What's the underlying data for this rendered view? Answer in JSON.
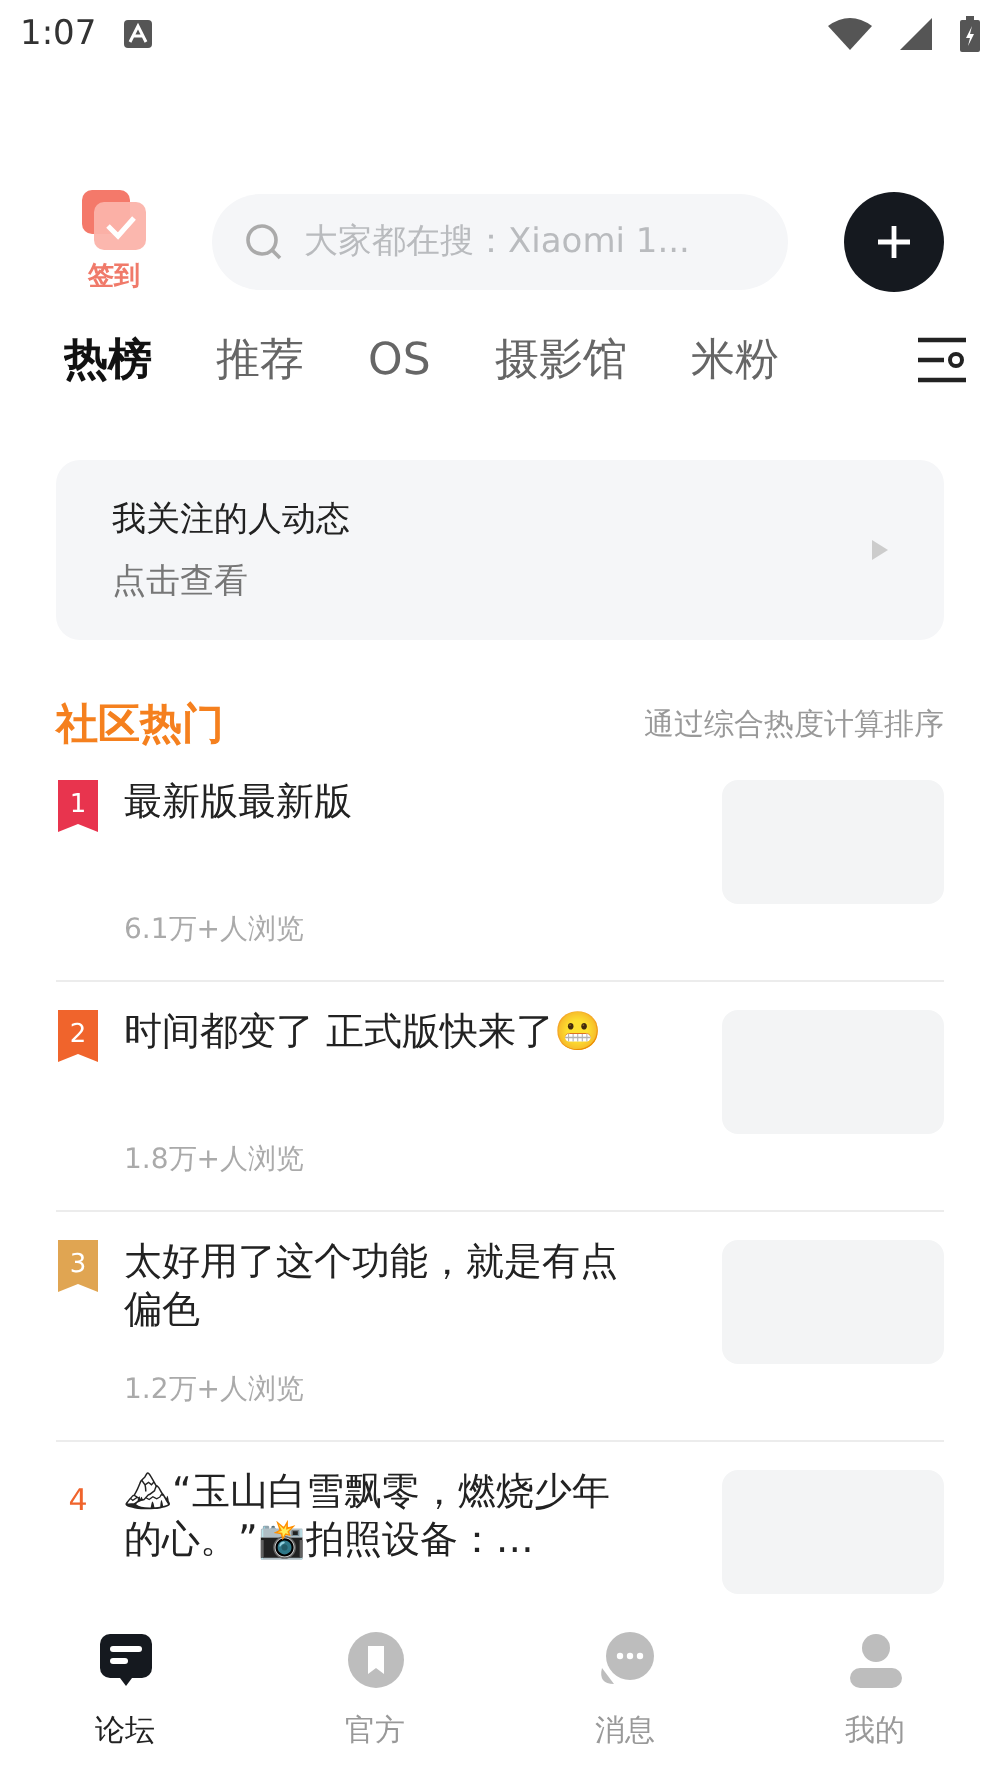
{
  "status_bar": {
    "time": "1:07"
  },
  "header": {
    "checkin_label": "签到",
    "search": {
      "placeholder": "大家都在搜：Xiaomi 1..."
    }
  },
  "tabs": [
    {
      "label": "热榜",
      "selected": true
    },
    {
      "label": "推荐",
      "selected": false
    },
    {
      "label": "OS",
      "selected": false
    },
    {
      "label": "摄影馆",
      "selected": false
    },
    {
      "label": "米粉",
      "selected": false
    }
  ],
  "follow_card": {
    "title": "我关注的人动态",
    "subtitle": "点击查看"
  },
  "section": {
    "title": "社区热门",
    "note": "通过综合热度计算排序"
  },
  "posts": [
    {
      "rank": "1",
      "kind": "ribbon",
      "color": "#e8344e",
      "title": "最新版最新版",
      "views": "6.1万+人浏览"
    },
    {
      "rank": "2",
      "kind": "ribbon",
      "color": "#f0642c",
      "title": "时间都变了 正式版快来了😬",
      "views": "1.8万+人浏览"
    },
    {
      "rank": "3",
      "kind": "ribbon",
      "color": "#e0a552",
      "title": "太好用了这个功能，就是有点偏色",
      "views": "1.2万+人浏览"
    },
    {
      "rank": "4",
      "kind": "plain",
      "color": "#f0642c",
      "title": "🏔“玉山白雪飘零，燃烧少年的心。”📸拍照设备：…"
    }
  ],
  "bottom_nav": [
    {
      "label": "论坛",
      "selected": true
    },
    {
      "label": "官方",
      "selected": false
    },
    {
      "label": "消息",
      "selected": false
    },
    {
      "label": "我的",
      "selected": false
    }
  ]
}
